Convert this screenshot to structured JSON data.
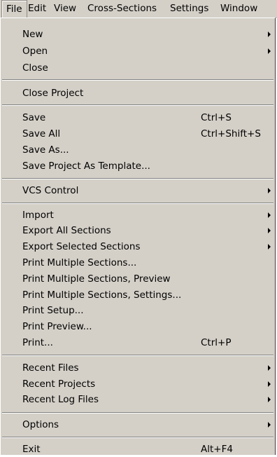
{
  "menubar": {
    "items": [
      "File",
      "Edit",
      "View",
      "Cross-Sections",
      "Settings",
      "Window"
    ],
    "active": "File"
  },
  "menu": {
    "new": {
      "label": "New",
      "submenu": true
    },
    "open": {
      "label": "Open",
      "submenu": true
    },
    "close": {
      "label": "Close"
    },
    "close_project": {
      "label": "Close Project"
    },
    "save": {
      "label": "Save",
      "shortcut": "Ctrl+S"
    },
    "save_all": {
      "label": "Save All",
      "shortcut": "Ctrl+Shift+S"
    },
    "save_as": {
      "label": "Save As..."
    },
    "save_template": {
      "label": "Save Project As Template..."
    },
    "vcs_control": {
      "label": "VCS Control",
      "submenu": true
    },
    "import": {
      "label": "Import",
      "submenu": true
    },
    "export_all": {
      "label": "Export All Sections",
      "submenu": true
    },
    "export_selected": {
      "label": "Export Selected Sections",
      "submenu": true
    },
    "print_multiple": {
      "label": "Print Multiple Sections..."
    },
    "print_multiple_preview": {
      "label": "Print Multiple Sections, Preview"
    },
    "print_multiple_settings": {
      "label": "Print Multiple Sections, Settings..."
    },
    "print_setup": {
      "label": "Print Setup..."
    },
    "print_preview": {
      "label": "Print Preview..."
    },
    "print": {
      "label": "Print...",
      "shortcut": "Ctrl+P"
    },
    "recent_files": {
      "label": "Recent Files",
      "submenu": true
    },
    "recent_projects": {
      "label": "Recent Projects",
      "submenu": true
    },
    "recent_log_files": {
      "label": "Recent Log Files",
      "submenu": true
    },
    "options": {
      "label": "Options",
      "submenu": true
    },
    "exit": {
      "label": "Exit",
      "shortcut": "Alt+F4"
    }
  }
}
